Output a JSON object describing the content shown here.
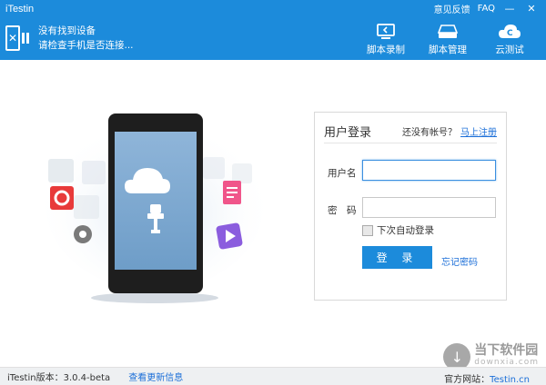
{
  "app": {
    "title": "iTestin",
    "feedback": "意见反馈",
    "faq": "FAQ",
    "minimize": "—",
    "close": "✕"
  },
  "device": {
    "status_title": "没有找到设备",
    "status_hint": "请检查手机是否连接..."
  },
  "toolbar": {
    "record_label": "脚本录制",
    "manage_label": "脚本管理",
    "cloud_label": "云测试"
  },
  "login": {
    "title": "用户登录",
    "no_account": "还没有帐号？",
    "register": "马上注册",
    "username_label": "用户名",
    "password_label": "密　码",
    "username_value": "",
    "password_value": "",
    "auto_login": "下次自动登录",
    "login_button": "登 录",
    "forgot": "忘记密码"
  },
  "footer": {
    "version": "iTestin版本：3.0.4-beta",
    "update": "查看更新信息",
    "site_label": "官方网站：",
    "site_link": "Testin.cn"
  },
  "watermark": {
    "cn": "当下软件园",
    "en": "downxia.com"
  },
  "colors": {
    "primary": "#1c8bdb",
    "link": "#1c6fd8"
  }
}
